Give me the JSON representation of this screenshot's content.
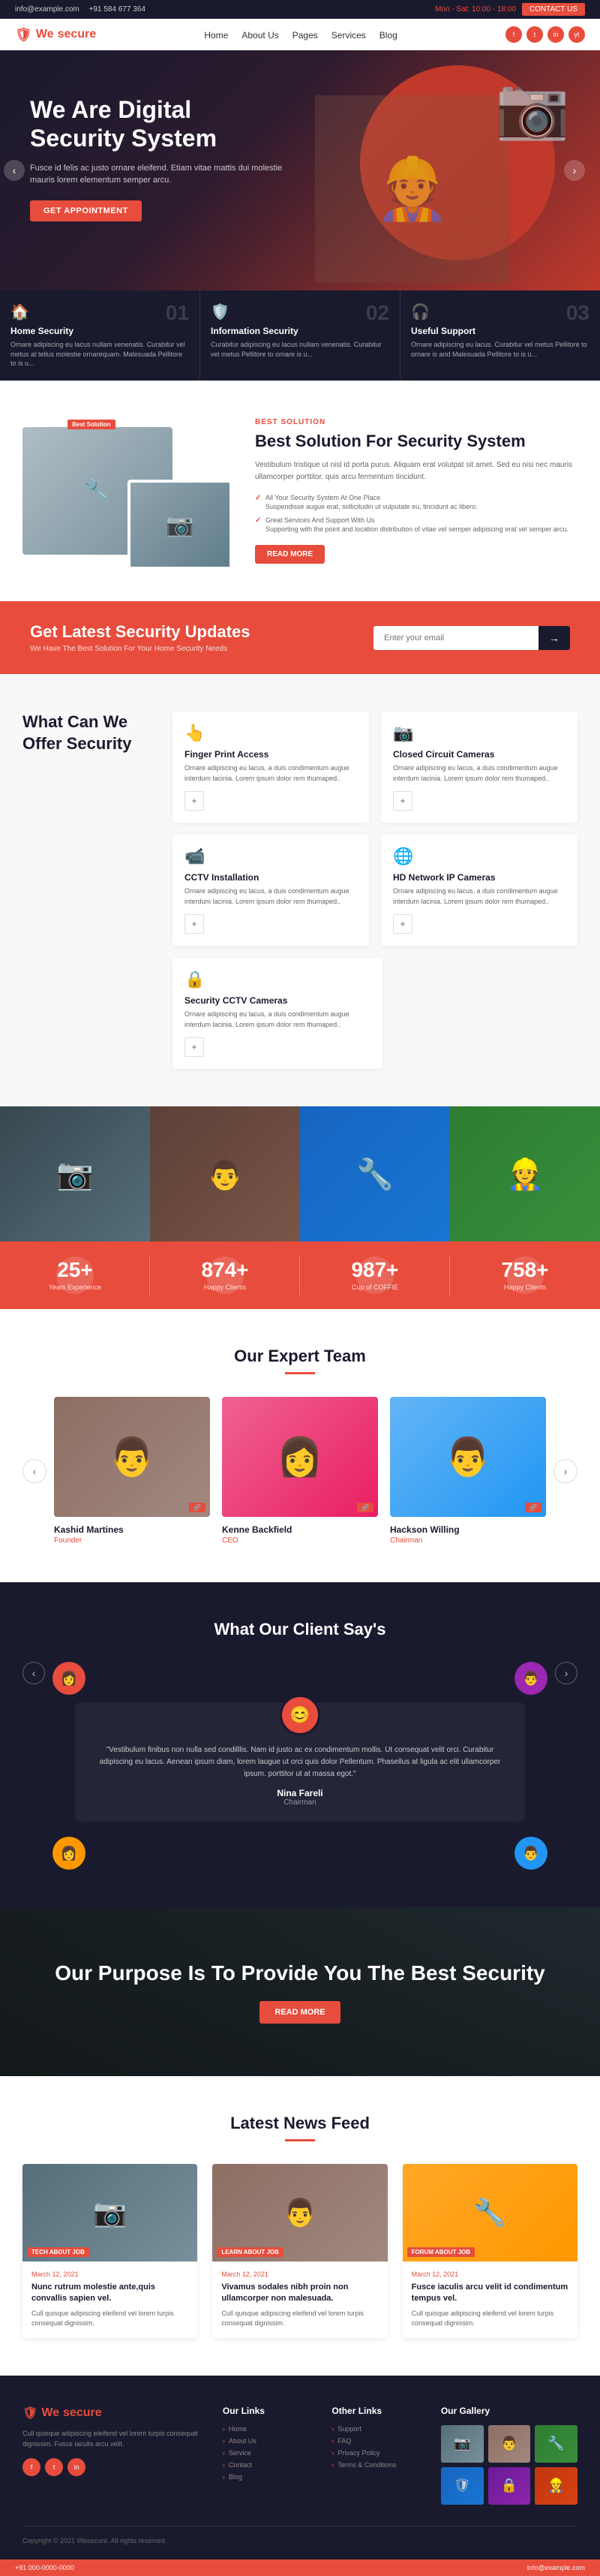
{
  "topbar": {
    "email": "info@example.com",
    "phone": "+91 584 677 364",
    "hours": "Mon - Sat: 10:00 - 18:00",
    "contact_btn": "CONTACT US"
  },
  "navbar": {
    "logo": "We",
    "logo_accent": "secure",
    "links": [
      "Home",
      "About Us",
      "Pages",
      "Services",
      "Blog"
    ],
    "social": [
      "f",
      "t",
      "in",
      "yt"
    ]
  },
  "hero": {
    "title": "We Are Digital Security System",
    "description": "Fusce id felis ac justo ornare eleifend. Etiam vitae mattis dui molestie mauris lorem elementum semper arcu.",
    "cta": "GET APPOINTMENT"
  },
  "features": [
    {
      "number": "01",
      "icon": "🏠",
      "title": "Home Security",
      "description": "Ornare adipiscing eu lacus nullam venenatis. Curabitur vel metus at tellus molestie ornarequam. Malesuada Pellitore to is u..."
    },
    {
      "number": "02",
      "icon": "🛡️",
      "title": "Information Security",
      "description": "Curabitur adipiscing eu lacus nullam venenatis. Curabitur vel metus Pellitore to ornare is u..."
    },
    {
      "number": "03",
      "icon": "🎧",
      "title": "Useful Support",
      "description": "Ornare adipiscing eu lacus. Curabitur vel metus Pellitore to ornare is and Malesuada Pellitore to is u..."
    }
  ],
  "solution": {
    "badge": "Best Solution",
    "title": "Best Solution For Security System",
    "description": "Vestibulum tristique ut nisl id porta purus. Aliquam erat volutpat sit amet. Sed eu nisi nec mauris ullamcorper porttitor. quis arcu fermentum tincidunt.",
    "points": [
      {
        "title": "All Your Security System At One Place",
        "description": "Suspendisse augue erat, sollicitudin ut vulputate eu, tincidunt ac libero."
      },
      {
        "title": "Great Services And Support With Us",
        "description": "Supporting with the point and location distribution of vitae vel semper adipiscing erat vel semper arcu."
      }
    ],
    "cta": "READ MORE"
  },
  "newsletter": {
    "title": "Get Latest Security Updates",
    "subtitle": "We Have The Best Solution For Your Home Security Needs",
    "placeholder": "Enter your email",
    "button_icon": "→"
  },
  "offer": {
    "title": "What Can We Offer Security",
    "cards": [
      {
        "icon": "👆",
        "title": "Finger Print Access",
        "description": "Ornare adipiscing eu lacus, a duis condimentum augue interdum lacinia. Lorem ipsum dolor rem thumaped.."
      },
      {
        "icon": "📷",
        "title": "Closed Circuit Cameras",
        "description": "Ornare adipiscing eu lacus, a duis condimentum augue interdum lacinia. Lorem ipsum dolor rem thumaped.."
      },
      {
        "icon": "📹",
        "title": "CCTV Installation",
        "description": "Ornare adipiscing eu lacus, a duis condimentum augue interdum lacinia. Lorem ipsum dolor rem thumaped.."
      },
      {
        "icon": "🌐",
        "title": "HD Network IP Cameras",
        "description": "Ornare adipiscing eu lacus, a duis condimentum augue interdum lacinia. Lorem ipsum dolor rem thumaped.."
      },
      {
        "icon": "🔒",
        "title": "Security CCTV Cameras",
        "description": "Ornare adipiscing eu lacus, a duis condimentum augue interdum lacinia. Lorem ipsum dolor rem thumaped.."
      }
    ]
  },
  "stats": [
    {
      "number": "25+",
      "label": "Years Experience"
    },
    {
      "number": "874+",
      "label": "Happy Clients"
    },
    {
      "number": "987+",
      "label": "Cup of COFFIE"
    },
    {
      "number": "758+",
      "label": "Happy Clients"
    }
  ],
  "team": {
    "title": "Our Expert Team",
    "members": [
      {
        "name": "Kashid Martines",
        "role": "Founder"
      },
      {
        "name": "Kenne Backfield",
        "role": "CEO"
      },
      {
        "name": "Hackson Willing",
        "role": "Chairman"
      }
    ]
  },
  "testimonials": {
    "title": "What Our Client Say's",
    "review": "\"Vestibulum finibus non nulla sed condilllis. Nam id justo ac ex condimentum mollis. Ut consequat velit orci. Curabitur adipiscing eu lacus. Aenean ipsum diam, lorem laugue ut orci quis dolor Pellentum. Phasellus at ligula ac elit ullamcorper ipsum. porttitor ut at massa egot.\"",
    "reviewer_name": "Nina Fareli",
    "reviewer_role": "Chairman"
  },
  "purpose": {
    "title": "Our Purpose Is To Provide You The Best Security",
    "cta": "READ MORE"
  },
  "news": {
    "title": "Latest News Feed",
    "articles": [
      {
        "tag": "TECH ABOUT JOB",
        "date": "March 12, 2021",
        "title": "Nunc rutrum molestie ante,quis convallis sapien vel.",
        "description": "Cull quisque adipiscing eleifend vel lorem turpis consequat dignissim.",
        "img_icon": "📷"
      },
      {
        "tag": "LEARN ABOUT JOB",
        "date": "March 12, 2021",
        "title": "Vivamus sodales nibh proin non ullamcorper non malesuada.",
        "description": "Cull quisque adipiscing eleifend vel lorem turpis consequat dignissim.",
        "img_icon": "👨"
      },
      {
        "tag": "FORUM ABOUT JOB",
        "date": "March 12, 2021",
        "title": "Fusce iaculis arcu velit id condimentum tempus vel.",
        "description": "Cull quisque adipiscing eleifend vel lorem turpis consequat dignissim.",
        "img_icon": "🔧"
      }
    ]
  },
  "footer": {
    "logo": "We",
    "logo_accent": "secure",
    "about": "Cull quisque adipiscing eleifend vel lorem turpis consequat dignissim. Fusce iaculis arcu velit.",
    "our_links": {
      "title": "Our Links",
      "items": [
        "Home",
        "About Us",
        "Service",
        "Contact",
        "Blog"
      ]
    },
    "other_links": {
      "title": "Other Links",
      "items": [
        "Support",
        "FAQ",
        "Privacy Policy",
        "Terms & Conditions"
      ]
    },
    "gallery": {
      "title": "Our Gallery"
    },
    "copyright": "Copyright © 2021 Wesecure. All rights reserved.",
    "contact_phone": "+91 000-0000-0000",
    "contact_email": "info@example.com"
  }
}
